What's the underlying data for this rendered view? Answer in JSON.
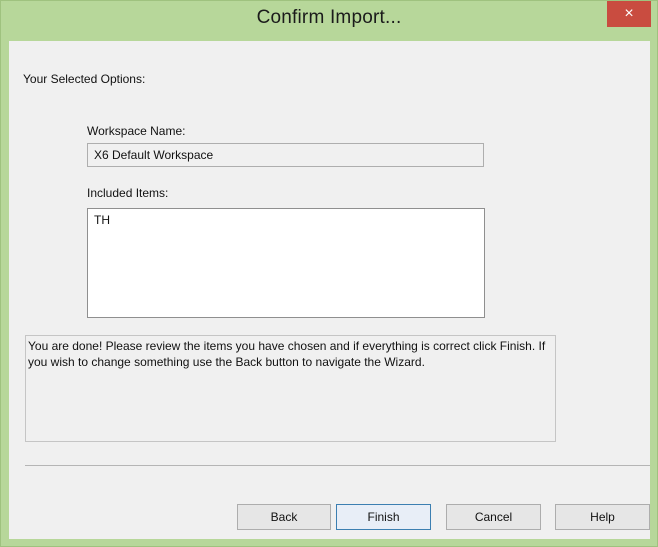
{
  "window": {
    "title": "Confirm Import...",
    "close_label": "×"
  },
  "content": {
    "options_heading": "Your Selected Options:",
    "workspace_name_label": "Workspace Name:",
    "workspace_name_value": "X6 Default Workspace",
    "included_items_label": "Included Items:",
    "included_items": [
      "TH"
    ],
    "info_text": "You are done! Please review the items you have chosen and if everything is correct click Finish. If you wish to change something use the Back button to navigate the Wizard."
  },
  "buttons": {
    "back": "Back",
    "finish": "Finish",
    "cancel": "Cancel",
    "help": "Help"
  },
  "colors": {
    "frame": "#b7d79a",
    "close": "#c94c40",
    "client": "#f0f0f0"
  }
}
